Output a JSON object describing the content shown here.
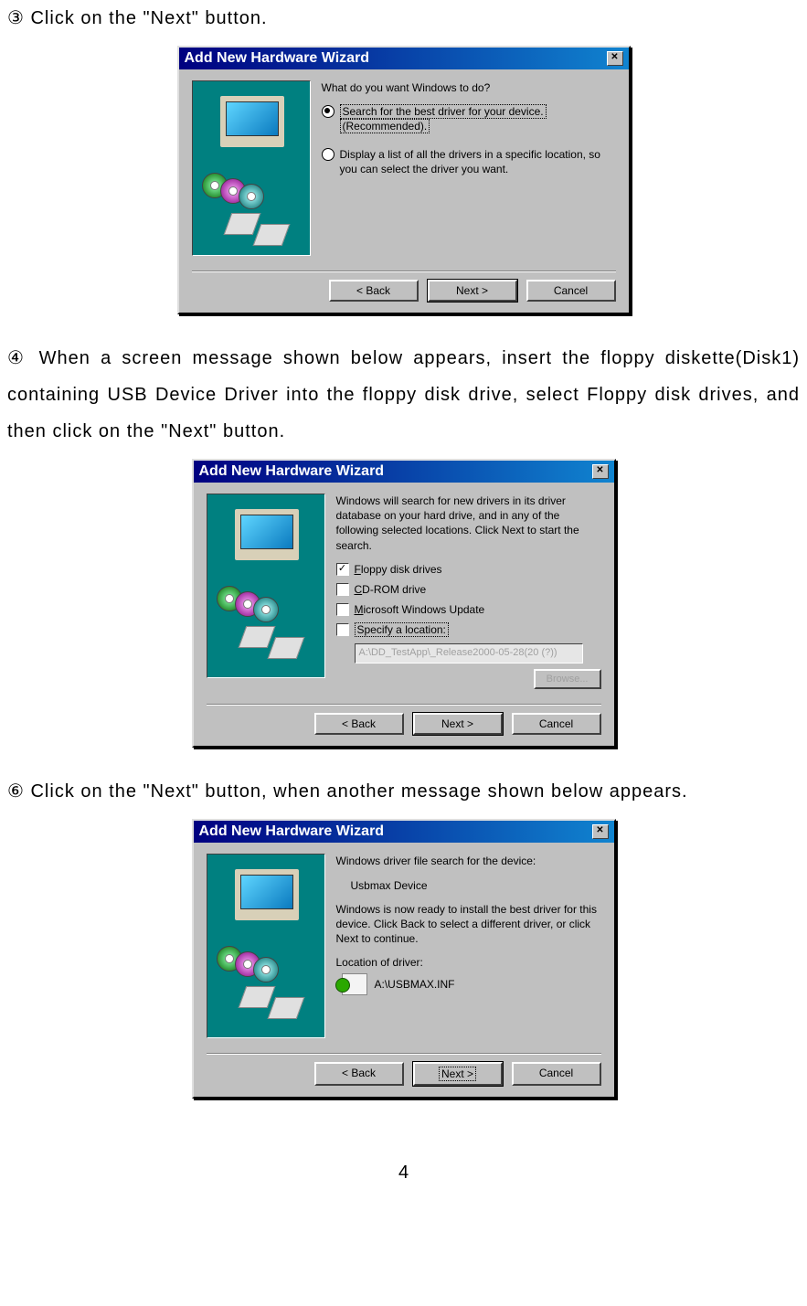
{
  "step3": "③ Click on the \"Next\" button.",
  "step4": "④ When a screen message shown below appears, insert the floppy diskette(Disk1) containing USB Device Driver into the floppy disk drive, select Floppy disk drives, and then click on the \"Next\" button.",
  "step6": "⑥ Click on the \"Next\" button, when another message shown below appears.",
  "page_number": "4",
  "dlg1": {
    "title": "Add New Hardware Wizard",
    "prompt": "What do you want Windows to do?",
    "opt1_line1": "Search for the best driver for your device.",
    "opt1_line2": "(Recommended).",
    "opt2": "Display a list of all the drivers in a specific location, so you can select the driver you want.",
    "back": "< Back",
    "next": "Next >",
    "cancel": "Cancel"
  },
  "dlg2": {
    "title": "Add New Hardware Wizard",
    "prompt": "Windows will search for new drivers in its driver database on your hard drive, and in any of the following selected locations. Click Next to start the search.",
    "chk_floppy": "Floppy disk drives",
    "chk_cdrom": "CD-ROM drive",
    "chk_msupdate": "Microsoft Windows Update",
    "chk_specify": "Specify a location:",
    "path": "A:\\DD_TestApp\\_Release2000-05-28(20 (?))",
    "browse": "Browse...",
    "back": "< Back",
    "next": "Next >",
    "cancel": "Cancel"
  },
  "dlg3": {
    "title": "Add New Hardware Wizard",
    "heading": "Windows driver file search for the device:",
    "device": "Usbmax Device",
    "ready": "Windows is now ready to install the best driver for this device. Click Back to select a different driver, or click Next to continue.",
    "loc_label": "Location of driver:",
    "inf": "A:\\USBMAX.INF",
    "back": "< Back",
    "next": "Next >",
    "cancel": "Cancel"
  }
}
